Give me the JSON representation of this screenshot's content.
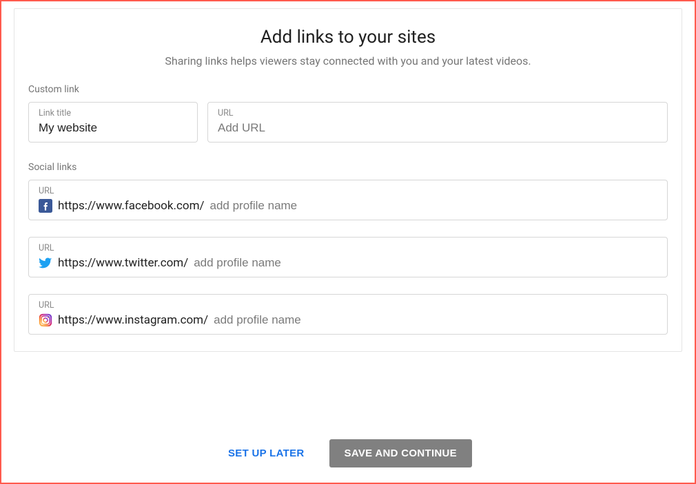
{
  "header": {
    "title": "Add links to your sites",
    "subtitle": "Sharing links helps viewers stay connected with you and your latest videos."
  },
  "custom": {
    "section_label": "Custom link",
    "title_field_label": "Link title",
    "title_field_value": "My website",
    "url_field_label": "URL",
    "url_field_placeholder": "Add URL",
    "url_field_value": ""
  },
  "social": {
    "section_label": "Social links",
    "items": [
      {
        "url_label": "URL",
        "icon": "facebook",
        "prefix": "https://www.facebook.com/",
        "suffix_placeholder": "add profile name",
        "value": ""
      },
      {
        "url_label": "URL",
        "icon": "twitter",
        "prefix": "https://www.twitter.com/",
        "suffix_placeholder": "add profile name",
        "value": ""
      },
      {
        "url_label": "URL",
        "icon": "instagram",
        "prefix": "https://www.instagram.com/",
        "suffix_placeholder": "add profile name",
        "value": ""
      }
    ]
  },
  "actions": {
    "secondary": "SET UP LATER",
    "primary": "SAVE AND CONTINUE"
  }
}
